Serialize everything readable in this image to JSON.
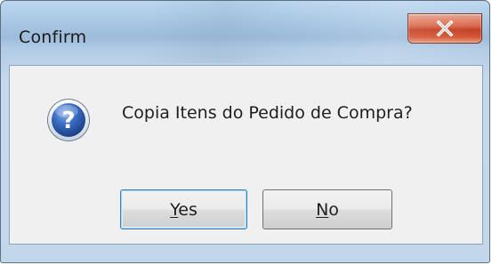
{
  "window": {
    "title": "Confirm",
    "close_icon": "close-icon"
  },
  "dialog": {
    "icon": "question-icon",
    "message": "Copia Itens do Pedido de Compra?"
  },
  "buttons": {
    "yes": {
      "mnemonic": "Y",
      "rest": "es"
    },
    "no": {
      "mnemonic": "N",
      "rest": "o"
    }
  },
  "colors": {
    "accent_icon": "#2a5db0",
    "close_red": "#c13b1f",
    "dialog_bg": "#f0f0f0"
  }
}
